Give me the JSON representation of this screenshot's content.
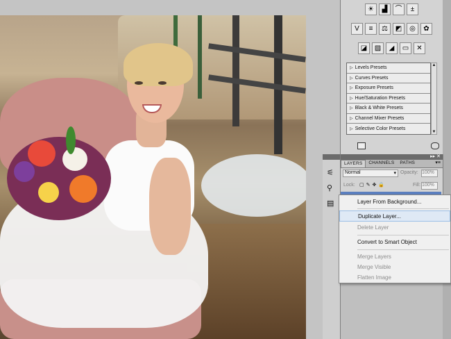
{
  "adjustments": {
    "row1_icons": [
      "brightness-contrast-icon",
      "levels-icon",
      "curves-icon",
      "exposure-icon"
    ],
    "row2_icons": [
      "vibrance-icon",
      "hue-saturation-icon",
      "color-balance-icon",
      "black-white-icon",
      "photo-filter-icon",
      "channel-mixer-icon"
    ],
    "row3_icons": [
      "invert-icon",
      "posterize-icon",
      "threshold-icon",
      "gradient-map-icon",
      "selective-color-icon"
    ],
    "presets": [
      {
        "label": "Levels Presets"
      },
      {
        "label": "Curves Presets"
      },
      {
        "label": "Exposure Presets"
      },
      {
        "label": "Hue/Saturation Presets"
      },
      {
        "label": "Black & White Presets"
      },
      {
        "label": "Channel Mixer Presets"
      },
      {
        "label": "Selective Color Presets"
      }
    ]
  },
  "layers": {
    "tabs": [
      {
        "label": "LAYERS"
      },
      {
        "label": "CHANNELS"
      },
      {
        "label": "PATHS"
      }
    ],
    "blend_mode": "Normal",
    "opacity_label": "Opacity:",
    "opacity_value": "100%",
    "lock_label": "Lock:",
    "fill_label": "Fill:",
    "fill_value": "100%"
  },
  "context_menu": {
    "items": [
      {
        "label": "Layer From Background...",
        "disabled": false,
        "hover": false
      },
      {
        "label": "Duplicate Layer...",
        "disabled": false,
        "hover": true
      },
      {
        "label": "Delete Layer",
        "disabled": true,
        "hover": false
      },
      {
        "label": "Convert to Smart Object",
        "disabled": false,
        "hover": false
      },
      {
        "label": "Merge Layers",
        "disabled": true,
        "hover": false
      },
      {
        "label": "Merge Visible",
        "disabled": true,
        "hover": false
      },
      {
        "label": "Flatten Image",
        "disabled": true,
        "hover": false
      }
    ]
  },
  "colors": {
    "panel_bg": "#d3d3d3",
    "menu_hover": "#dfe9f5",
    "disabled_text": "#8c8c8c"
  }
}
